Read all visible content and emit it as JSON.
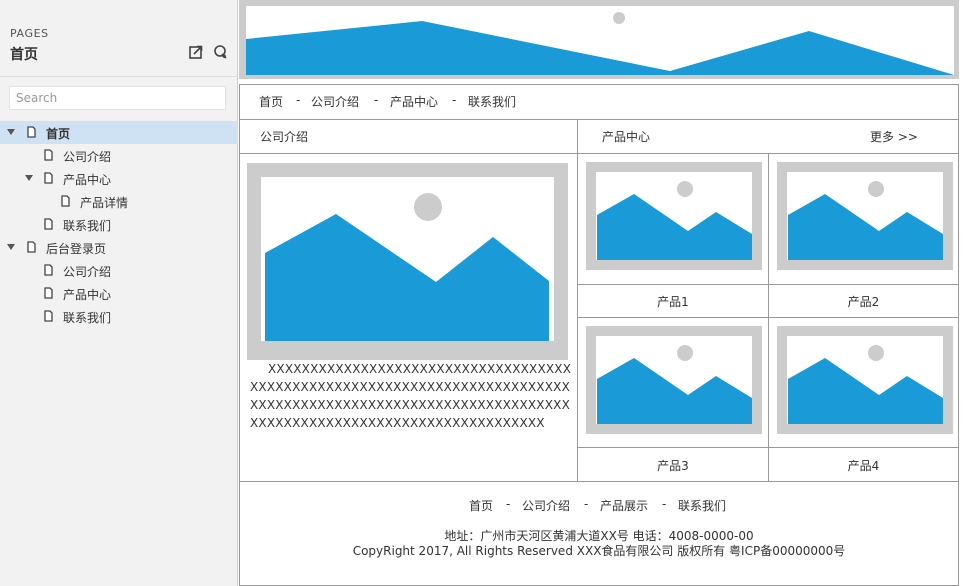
{
  "sidebar": {
    "caption": "PAGES",
    "title": "首页",
    "search_placeholder": "Search",
    "tree": [
      {
        "label": "首页",
        "level": 0,
        "expandable": true,
        "selected": true
      },
      {
        "label": "公司介绍",
        "level": 1,
        "expandable": false
      },
      {
        "label": "产品中心",
        "level": 1,
        "expandable": true
      },
      {
        "label": "产品详情",
        "level": 2,
        "expandable": false
      },
      {
        "label": "联系我们",
        "level": 1,
        "expandable": false
      },
      {
        "label": "后台登录页",
        "level": 0,
        "expandable": true
      },
      {
        "label": "公司介绍",
        "level": 1,
        "expandable": false
      },
      {
        "label": "产品中心",
        "level": 1,
        "expandable": false
      },
      {
        "label": "联系我们",
        "level": 1,
        "expandable": false
      }
    ]
  },
  "page": {
    "nav": {
      "items": [
        "首页",
        "公司介绍",
        "产品中心",
        "联系我们"
      ],
      "separator": "-"
    },
    "intro": {
      "title": "公司介绍",
      "text": "XXXXXXXXXXXXXXXXXXXXXXXXXXXXXXXXXXXXXXXXXXXXXXXXXXXXXXXXXXXXXXXXXXXXXXXXXXXXXXXXXXXXXXXXXXXXXXXXXXXXXXXXXXXXXXXXXXXXXXXXXXXXXXXXXXXXXXXXXXXXXXXXXXX"
    },
    "products": {
      "title": "产品中心",
      "more": "更多 >>",
      "items": [
        "产品1",
        "产品2",
        "产品3",
        "产品4"
      ]
    },
    "footer": {
      "nav": [
        "首页",
        "公司介绍",
        "产品展示",
        "联系我们"
      ],
      "separator": "-",
      "address": "地址：广州市天河区黄浦大道XX号  电话：4008-0000-00",
      "copyright": "CopyRight 2017, All Rights Reserved   XXX食品有限公司 版权所有 粤ICP备00000000号"
    }
  },
  "colors": {
    "image_blue": "#1a9ad6",
    "placeholder_gray": "#cccccc",
    "selected_row": "#cfe2f3"
  }
}
